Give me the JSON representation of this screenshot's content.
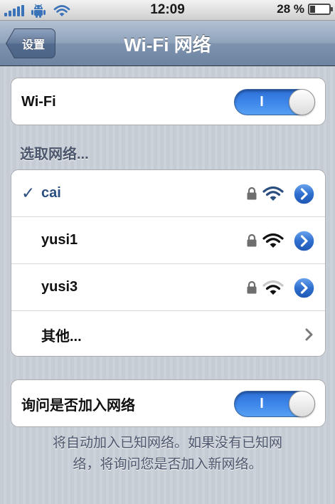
{
  "status_bar": {
    "time": "12:09",
    "battery_text": "28 %",
    "battery_level": 0.28,
    "signal_icon": "signal-bars-icon",
    "android_icon": "android-robot-icon",
    "wifi_icon": "wifi-icon"
  },
  "nav": {
    "back_label": "设置",
    "title": "Wi-Fi 网络"
  },
  "wifi_group": {
    "label": "Wi-Fi",
    "toggle_text": "I",
    "toggle_on": true
  },
  "section": {
    "header": "选取网络..."
  },
  "networks": [
    {
      "name": "cai",
      "selected": true,
      "checkmark": "✓",
      "locked": true,
      "signal_level": 3
    },
    {
      "name": "yusi1",
      "selected": false,
      "locked": true,
      "signal_level": 3
    },
    {
      "name": "yusi3",
      "selected": false,
      "locked": true,
      "signal_level": 2
    }
  ],
  "other": {
    "label": "其他..."
  },
  "ask_group": {
    "label": "询问是否加入网络",
    "toggle_text": "I",
    "toggle_on": true
  },
  "footer": {
    "line1": "将自动加入已知网络。如果没有已知网",
    "line2": "络，将询问您是否加入新网络。"
  },
  "colors": {
    "nav_bar": "#7d93ae",
    "toggle_on": "#3d86ea",
    "selected_text": "#2b4e80",
    "detail_button": "#2f6fd0",
    "background": "#c5ccd4"
  }
}
